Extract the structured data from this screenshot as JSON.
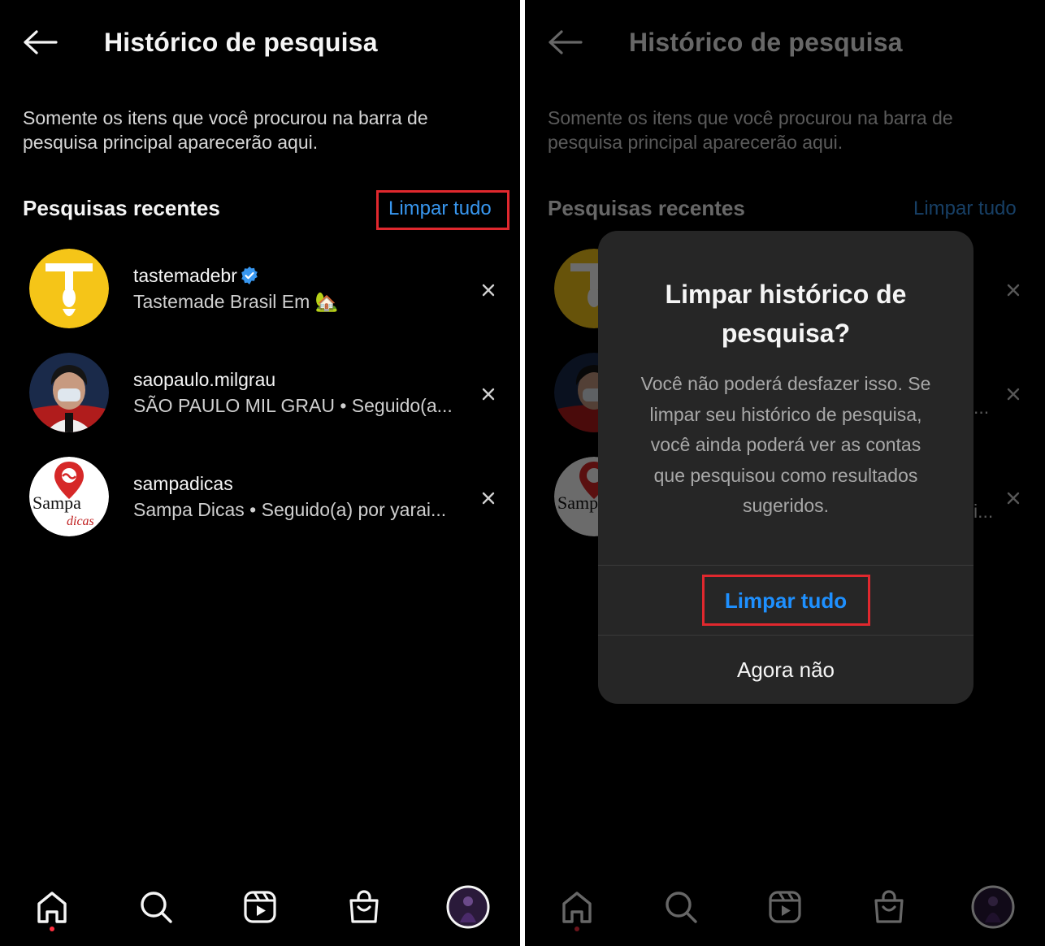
{
  "theme": {
    "background": "#000000",
    "text": "#f5f5f5",
    "link": "#3897f0",
    "highlight": "#e0282e",
    "dialog_bg": "#262626",
    "notification_dot": "#ff3040"
  },
  "screens": [
    {
      "header": {
        "back_icon": "arrow-left-icon",
        "title": "Histórico de pesquisa"
      },
      "description": "Somente os itens que você procurou na barra de pesquisa principal aparecerão aqui.",
      "section": {
        "title": "Pesquisas recentes",
        "clear_all": "Limpar tudo"
      },
      "recent": [
        {
          "username": "tastemadebr",
          "verified": true,
          "subtitle": "Tastemade Brasil Em 🏡"
        },
        {
          "username": "saopaulo.milgrau",
          "verified": false,
          "subtitle": "SÃO PAULO MIL GRAU • Seguido(a..."
        },
        {
          "username": "sampadicas",
          "verified": false,
          "subtitle": "Sampa Dicas • Seguido(a) por yarai..."
        }
      ],
      "nav": [
        "home-icon",
        "search-icon",
        "reels-icon",
        "shop-icon",
        "profile-avatar"
      ]
    },
    {
      "header": {
        "back_icon": "arrow-left-icon",
        "title": "Histórico de pesquisa"
      },
      "description": "Somente os itens que você procurou na barra de pesquisa principal aparecerão aqui.",
      "section": {
        "title": "Pesquisas recentes",
        "clear_all": "Limpar tudo"
      },
      "recent_suffixes": [
        "...",
        "i..."
      ],
      "dialog": {
        "title": "Limpar histórico de pesquisa?",
        "body": "Você não poderá desfazer isso. Se limpar seu histórico de pesquisa, você ainda poderá ver as contas que pesquisou como resultados sugeridos.",
        "confirm": "Limpar tudo",
        "cancel": "Agora não"
      }
    }
  ]
}
